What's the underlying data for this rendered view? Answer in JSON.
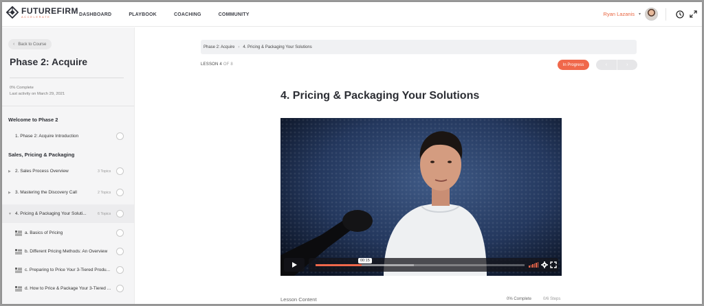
{
  "brand": {
    "name": "FUTUREFIRM",
    "tagline": "ACCELERATE",
    "accent": "#e8643f"
  },
  "nav": {
    "items": [
      "DASHBOARD",
      "PLAYBOOK",
      "COACHING",
      "COMMUNITY"
    ]
  },
  "user": {
    "name": "Ryan Lazanis",
    "caret": "▾"
  },
  "icons": {
    "history": "clock-icon",
    "fullscreen": "expand-icon"
  },
  "sidebar": {
    "back_label": "Back to Course",
    "course_title": "Phase 2: Acquire",
    "progress": "0% Complete",
    "progress_value": 0,
    "last_activity": "Last activity on March 29, 2021",
    "sections": [
      {
        "title": "Welcome to Phase 2"
      },
      {
        "title": "Sales, Pricing & Packaging"
      }
    ],
    "lessons": [
      {
        "label": "1. Phase 2: Acquire Introduction",
        "topics": ""
      },
      {
        "label": "2. Sales Process Overview",
        "topics": "3 Topics"
      },
      {
        "label": "3. Mastering the Discovery Call",
        "topics": "2 Topics"
      },
      {
        "label": "4. Pricing & Packaging Your Soluti...",
        "topics": "6 Topics"
      }
    ],
    "topics": [
      {
        "label": "a. Basics of Pricing"
      },
      {
        "label": "b. Different Pricing Methods: An Overview"
      },
      {
        "label": "c. Preparing to Price Your 3-Tiered Produ..."
      },
      {
        "label": "d. How to Price & Package Your 3-Tiered ..."
      }
    ]
  },
  "main": {
    "breadcrumb": {
      "parent": "Phase 2: Acquire",
      "separator": "›",
      "current": "4. Pricing & Packaging Your Solutions"
    },
    "lesson_prefix": "LESSON 4",
    "lesson_of": "OF 8",
    "status": "In Progress",
    "status_color": "#f0684b",
    "pager": {
      "prev": "‹",
      "next": "›"
    },
    "title": "4. Pricing & Packaging Your Solutions",
    "video": {
      "time": "00:15",
      "played_fraction": 0.22
    },
    "lesson_content": {
      "heading": "Lesson Content",
      "complete": "0% Complete",
      "steps": "0/6 Steps"
    }
  }
}
